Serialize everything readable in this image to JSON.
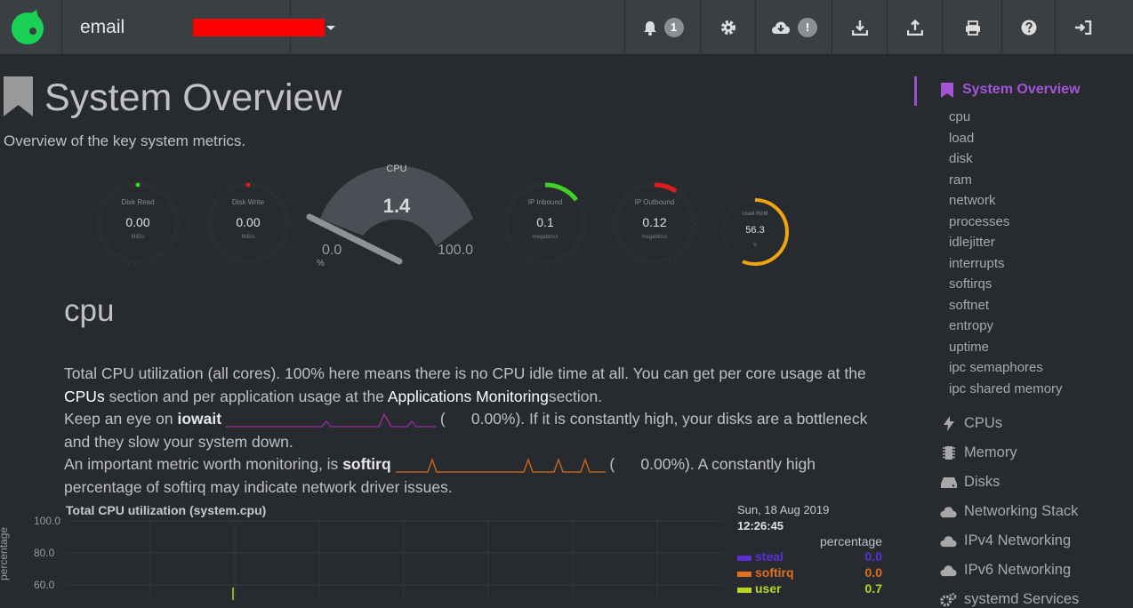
{
  "navbar": {
    "server_label": "email",
    "buttons": [
      {
        "icon": "bell-icon",
        "badge": "1"
      },
      {
        "icon": "gear-icon"
      },
      {
        "icon": "cloud-download-icon",
        "badge": "!"
      },
      {
        "icon": "download-icon"
      },
      {
        "icon": "upload-icon"
      },
      {
        "icon": "print-icon"
      },
      {
        "icon": "question-circle-icon"
      },
      {
        "icon": "sign-in-icon"
      }
    ]
  },
  "page": {
    "title": "System Overview",
    "subtitle": "Overview of the key system metrics."
  },
  "gauges": {
    "disk_read": {
      "title": "Disk Read",
      "value": "0.00",
      "unit": "MiB/s"
    },
    "disk_write": {
      "title": "Disk Write",
      "value": "0.00",
      "unit": "MiB/s"
    },
    "cpu": {
      "title": "CPU",
      "value": "1.4",
      "min": "0.0",
      "max": "100.0",
      "unit": "%"
    },
    "ip_inbound": {
      "title": "IP Inbound",
      "value": "0.1",
      "unit": "megabits/s"
    },
    "ip_outbound": {
      "title": "IP Outbound",
      "value": "0.12",
      "unit": "megabits/s"
    },
    "used_ram": {
      "title": "Used RAM",
      "value": "56.3",
      "unit": "%",
      "fraction": 0.563
    }
  },
  "section": {
    "title": "cpu",
    "desc_1": "Total CPU utilization (all cores). 100% here means there is no CPU idle time at all. You can get per core usage at the",
    "link_cpus": "CPUs",
    "desc_2": "section and per application usage at the",
    "link_apps": "Applications Monitoring",
    "desc_3": "section.",
    "iowait_pre": "Keep an eye on",
    "iowait_name": "iowait",
    "iowait_paren": "(",
    "iowait_value": "0.00%",
    "iowait_post": "). If it is constantly high, your disks are a bottleneck and they slow your system down.",
    "softirq_pre": "An important metric worth monitoring, is",
    "softirq_name": "softirq",
    "softirq_paren": "(",
    "softirq_value": "0.00%",
    "softirq_post": "). A constantly high percentage of softirq may indicate network driver issues."
  },
  "chart": {
    "title": "Total CPU utilization (system.cpu)",
    "ylabel": "percentage",
    "date": "Sun, 18 Aug 2019",
    "time": "12:26:45",
    "unit": "percentage",
    "yticks": [
      "100.0",
      "80.0",
      "60.0"
    ]
  },
  "chart_data": {
    "type": "area",
    "title": "Total CPU utilization (system.cpu)",
    "ylabel": "percentage",
    "ylim": [
      0,
      100
    ],
    "series": [
      {
        "name": "steal",
        "color": "#5a2fd6",
        "value": "0.0"
      },
      {
        "name": "softirq",
        "color": "#e0701a",
        "value": "0.0"
      },
      {
        "name": "user",
        "color": "#b8d41e",
        "value": "0.7"
      }
    ]
  },
  "colors": {
    "accent": "#a355d6",
    "iowait": "#9b2ea0",
    "softirq": "#d46a1a",
    "gauge_green": "#3fd12a",
    "gauge_red": "#e01b1b",
    "gauge_orange": "#f0a30a"
  },
  "sidebar": {
    "active": "System Overview",
    "sub_items": [
      "cpu",
      "load",
      "disk",
      "ram",
      "network",
      "processes",
      "idlejitter",
      "interrupts",
      "softirqs",
      "softnet",
      "entropy",
      "uptime",
      "ipc semaphores",
      "ipc shared memory"
    ],
    "sections": [
      {
        "label": "CPUs",
        "icon": "bolt-icon"
      },
      {
        "label": "Memory",
        "icon": "memory-chip-icon"
      },
      {
        "label": "Disks",
        "icon": "hdd-icon"
      },
      {
        "label": "Networking Stack",
        "icon": "cloud-icon"
      },
      {
        "label": "IPv4 Networking",
        "icon": "cloud-icon"
      },
      {
        "label": "IPv6 Networking",
        "icon": "cloud-icon"
      },
      {
        "label": "systemd Services",
        "icon": "gears-icon"
      }
    ]
  }
}
